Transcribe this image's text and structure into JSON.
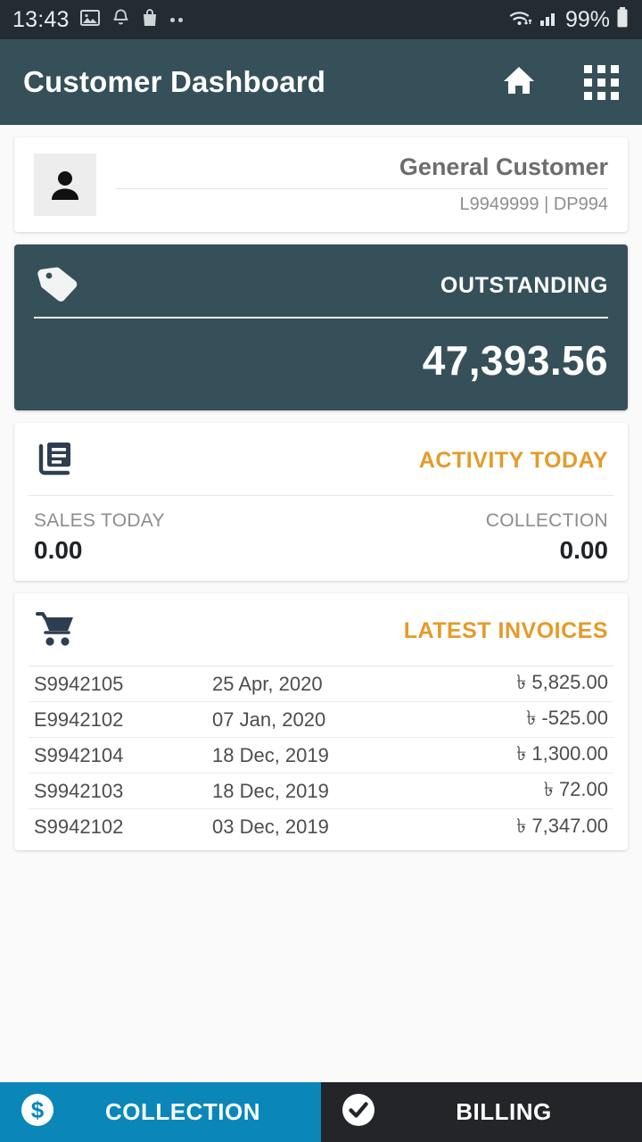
{
  "statusbar": {
    "time": "13:43",
    "battery_percent": "99%",
    "icons": [
      "image-icon",
      "bell-icon",
      "shopping-bag-icon",
      "more-dots-icon",
      "wifi-icon",
      "cellular-signal-icon",
      "battery-icon"
    ]
  },
  "appbar": {
    "title": "Customer Dashboard",
    "home_icon": "home-icon",
    "apps_icon": "apps-grid-icon"
  },
  "customer": {
    "avatar_icon": "person-avatar-icon",
    "name": "General Customer",
    "id": "L9949999 | DP994"
  },
  "outstanding": {
    "icon": "price-tag-icon",
    "label": "OUTSTANDING",
    "value": "47,393.56"
  },
  "activity": {
    "icon": "newspaper-icon",
    "title": "ACTIVITY TODAY",
    "sales_label": "SALES TODAY",
    "sales_value": "0.00",
    "collection_label": "COLLECTION",
    "collection_value": "0.00"
  },
  "invoices": {
    "icon": "shopping-cart-icon",
    "title": "LATEST INVOICES",
    "rows": [
      {
        "id": "S9942105",
        "date": "25 Apr, 2020",
        "amount": "৳ 5,825.00"
      },
      {
        "id": "E9942102",
        "date": "07 Jan, 2020",
        "amount": "৳ -525.00"
      },
      {
        "id": "S9942104",
        "date": "18 Dec, 2019",
        "amount": "৳ 1,300.00"
      },
      {
        "id": "S9942103",
        "date": "18 Dec, 2019",
        "amount": "৳ 72.00"
      },
      {
        "id": "S9942102",
        "date": "03 Dec, 2019",
        "amount": "৳ 7,347.00"
      }
    ]
  },
  "bottombar": {
    "collection_label": "COLLECTION",
    "collection_icon": "dollar-circle-icon",
    "billing_label": "BILLING",
    "billing_icon": "check-circle-icon"
  },
  "colors": {
    "appbar": "#36505a",
    "accent_orange": "#e59b28",
    "tab_collection": "#0a87b8",
    "tab_billing": "#232528",
    "statusbar": "#232b33",
    "page_background": "#fafafa"
  }
}
